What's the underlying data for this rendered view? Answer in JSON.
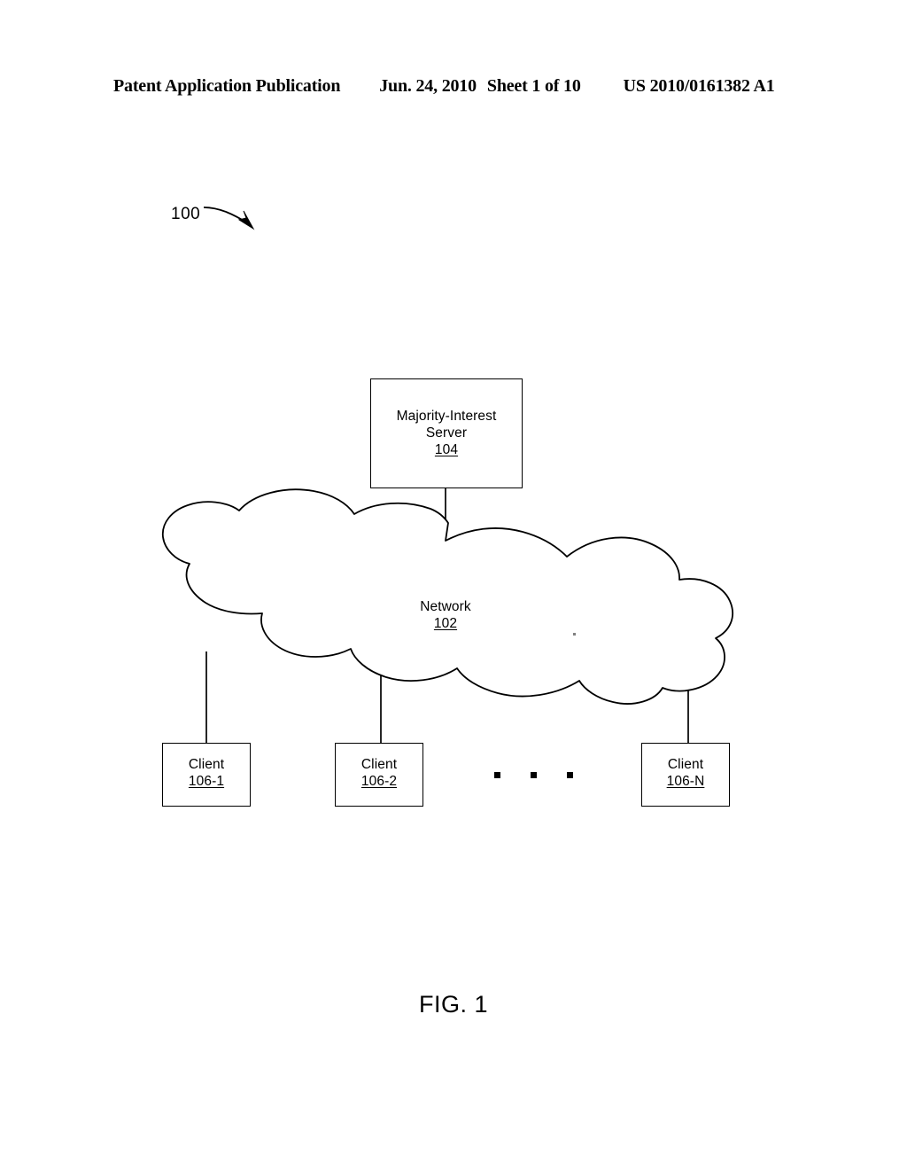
{
  "header": {
    "title": "Patent Application Publication",
    "date": "Jun. 24, 2010",
    "sheet": "Sheet 1 of 10",
    "number": "US 2010/0161382 A1"
  },
  "figure": {
    "system_reference": "100",
    "caption": "FIG. 1",
    "ellipsis_dot_count": 3
  },
  "nodes": {
    "server": {
      "line1": "Majority-Interest",
      "line2": "Server",
      "ref": "104"
    },
    "network": {
      "label": "Network",
      "ref": "102"
    },
    "clients": [
      {
        "label": "Client",
        "ref": "106-1"
      },
      {
        "label": "Client",
        "ref": "106-2"
      },
      {
        "label": "Client",
        "ref": "106-N"
      }
    ]
  },
  "colors": {
    "ink": "#000000",
    "paper": "#ffffff"
  }
}
